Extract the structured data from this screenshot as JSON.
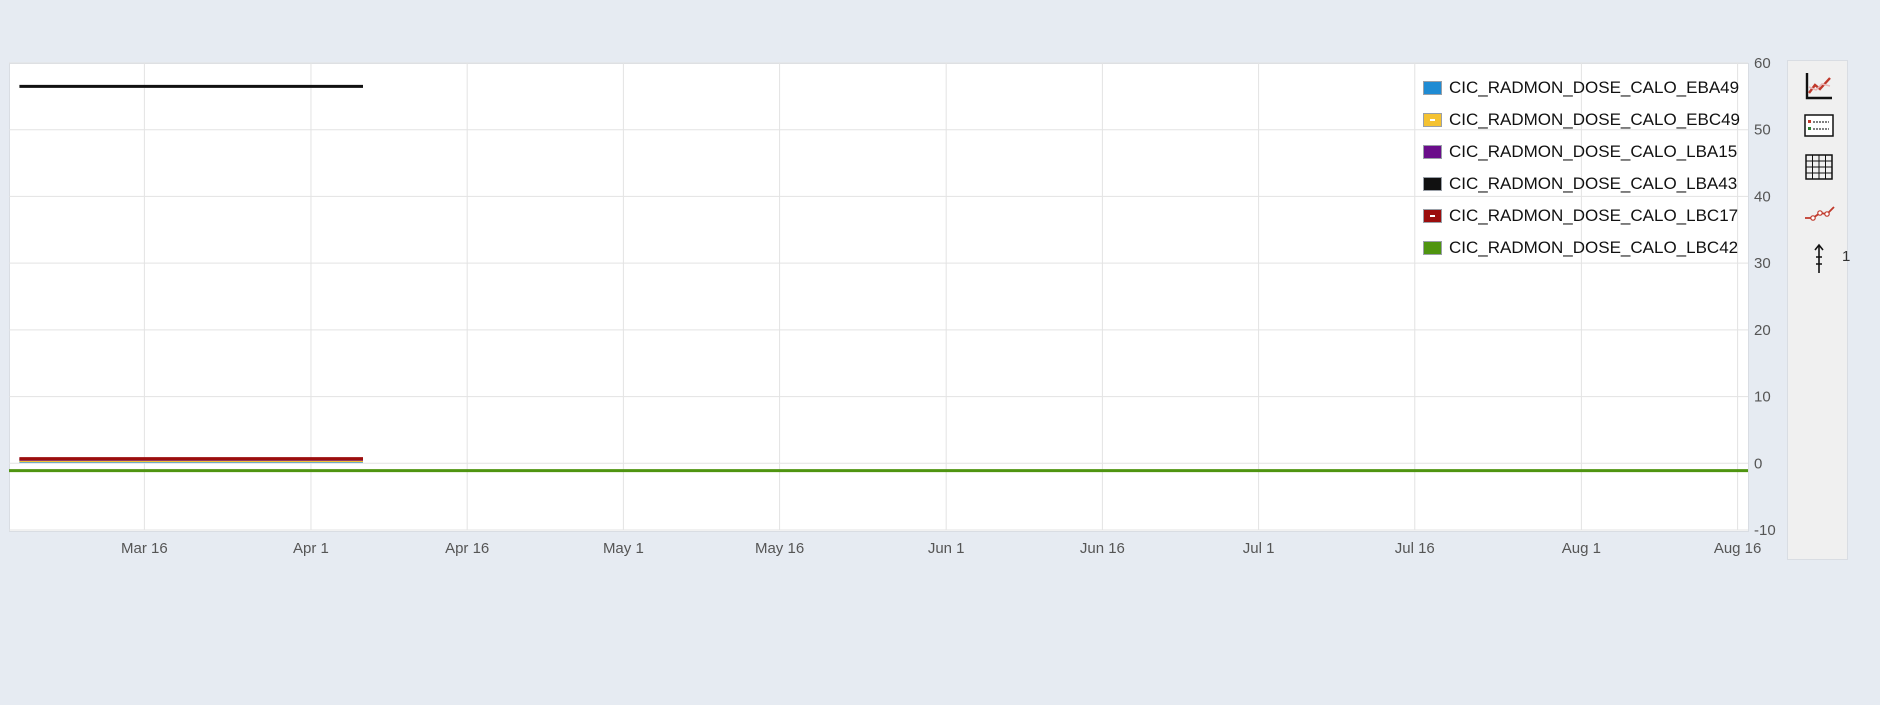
{
  "chart_data": {
    "type": "line",
    "title": "",
    "xlabel": "",
    "ylabel": "",
    "x_ticks": [
      "Mar 16",
      "Apr 1",
      "Apr 16",
      "May 1",
      "May 16",
      "Jun 1",
      "Jun 16",
      "Jul 1",
      "Jul 16",
      "Aug 1",
      "Aug 16"
    ],
    "y_ticks": [
      60,
      50,
      40,
      30,
      20,
      10,
      0,
      -10
    ],
    "xlim": [
      "2021-03-03",
      "2021-08-17"
    ],
    "ylim": [
      -10,
      60
    ],
    "y_axis_position": "right",
    "grid": true,
    "legend_position": "top-right",
    "series": [
      {
        "name": "CIC_RADMON_DOSE_CALO_EBA49",
        "color": "#1f8bd3",
        "x": [
          "2021-03-04",
          "2021-04-06"
        ],
        "y": [
          0.3,
          0.3
        ]
      },
      {
        "name": "CIC_RADMON_DOSE_CALO_EBC49",
        "color": "#f4c232",
        "x": [
          "2021-03-04",
          "2021-04-06"
        ],
        "y": [
          0.4,
          0.4
        ]
      },
      {
        "name": "CIC_RADMON_DOSE_CALO_LBA15",
        "color": "#6a0d8a",
        "x": [
          "2021-03-04",
          "2021-04-06"
        ],
        "y": [
          0.6,
          0.6
        ]
      },
      {
        "name": "CIC_RADMON_DOSE_CALO_LBA43",
        "color": "#111111",
        "x": [
          "2021-03-04",
          "2021-04-06"
        ],
        "y": [
          56.5,
          56.5
        ]
      },
      {
        "name": "CIC_RADMON_DOSE_CALO_LBC17",
        "color": "#9b0d0d",
        "x": [
          "2021-03-04",
          "2021-04-06"
        ],
        "y": [
          0.7,
          0.7
        ]
      },
      {
        "name": "CIC_RADMON_DOSE_CALO_LBC42",
        "color": "#4f9410",
        "x": [
          "2021-03-03",
          "2021-08-17"
        ],
        "y": [
          -1.1,
          -1.1
        ]
      }
    ]
  },
  "toolbar": {
    "tools": [
      "chart-icon",
      "legend-icon",
      "grid-icon",
      "markers-icon",
      "axis-scale-icon"
    ],
    "axis_count": "1"
  }
}
